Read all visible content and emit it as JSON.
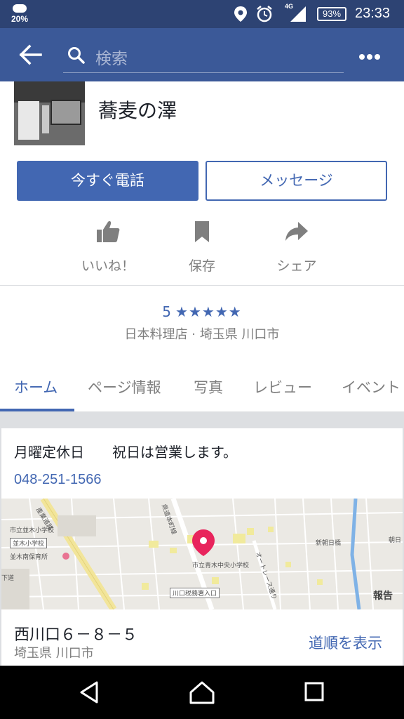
{
  "status_bar": {
    "weather_percent": "20%",
    "network": "4G",
    "battery": "93%",
    "time": "23:33",
    "icons": [
      "cloud-icon",
      "location-icon",
      "alarm-icon",
      "signal-icon",
      "battery-icon"
    ]
  },
  "app_bar": {
    "search_placeholder": "検索",
    "icons": [
      "back-arrow-icon",
      "search-icon",
      "more-icon"
    ]
  },
  "page": {
    "name": "蕎麦の澤",
    "call_button": "今すぐ電話",
    "message_button": "メッセージ",
    "actions": [
      {
        "label": "いいね！",
        "icon": "thumbs-up-icon"
      },
      {
        "label": "保存",
        "icon": "bookmark-icon"
      },
      {
        "label": "シェア",
        "icon": "share-icon"
      }
    ],
    "rating": "5",
    "rating_stars": "★★★★★",
    "rating_value": 5,
    "category": "日本料理店 · 埼玉県 川口市"
  },
  "tabs": [
    "ホーム",
    "ページ情報",
    "写真",
    "レビュー",
    "イベント"
  ],
  "active_tab": "ホーム",
  "info": {
    "hours": "月曜定休日　　祝日は営業します。",
    "phone": "048-251-1566",
    "address": "西川口６－８－５",
    "prefecture": "埼玉県 川口市",
    "directions": "道順を表示"
  },
  "map": {
    "labels": {
      "school1": "市立並木小学校",
      "school2": "並木小学校",
      "nursery": "並木南保育所",
      "road_left": "産業道路",
      "road_mid": "県道本町線",
      "school3": "市立青木中央小学校",
      "race": "オートレース通り",
      "bridge": "新朝日橋",
      "asahi": "朝日",
      "tax": "川口税務署入口",
      "shita": "下道",
      "report": "報告"
    }
  },
  "colors": {
    "facebook_blue": "#3b5998",
    "accent_blue": "#4267b2",
    "status_bar": "#2d4373",
    "map_pin": "#e8245c"
  }
}
